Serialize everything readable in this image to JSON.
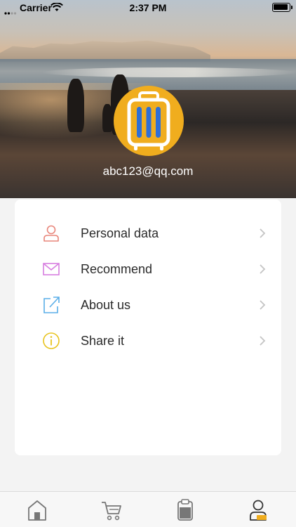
{
  "status_bar": {
    "carrier": "Carrier",
    "time": "2:37 PM"
  },
  "profile": {
    "email": "abc123@qq.com",
    "avatar_icon": "suitcase-icon",
    "avatar_color": "#f0ad1e"
  },
  "menu": {
    "items": [
      {
        "label": "Personal data",
        "icon": "person-icon",
        "color": "#e8857a"
      },
      {
        "label": "Recommend",
        "icon": "envelope-icon",
        "color": "#d77ee0"
      },
      {
        "label": "About us",
        "icon": "share-out-icon",
        "color": "#5aaee8"
      },
      {
        "label": "Share it",
        "icon": "info-icon",
        "color": "#e8c31e"
      }
    ]
  },
  "tab_bar": {
    "tabs": [
      {
        "icon": "home-icon",
        "active": false
      },
      {
        "icon": "cart-icon",
        "active": false
      },
      {
        "icon": "clipboard-icon",
        "active": false
      },
      {
        "icon": "profile-icon",
        "active": true
      }
    ],
    "active_color": "#f0ad1e"
  }
}
